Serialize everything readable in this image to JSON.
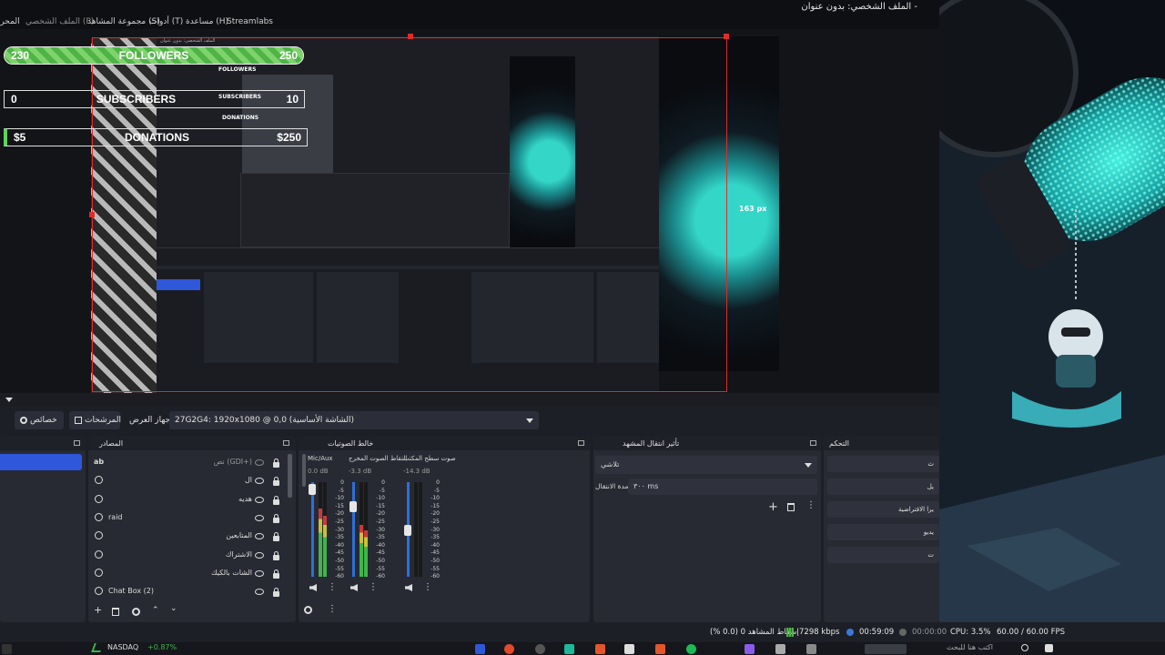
{
  "window": {
    "title": "الملف الشخصي: بدون عنوان -"
  },
  "menu": {
    "items": [
      "المحرر",
      "الملف الشخصي (P)",
      "مجموعة المشاهد (S)",
      "أدوات (T)",
      "مساعدة (H)",
      "Streamlabs"
    ]
  },
  "overlay": {
    "followers": {
      "left": "230",
      "label": "FOLLOWERS",
      "right": "250"
    },
    "subscribers": {
      "left": "0",
      "label": "SUBSCRIBERS",
      "right": "10"
    },
    "donations": {
      "left": "$5",
      "label": "DONATIONS",
      "right": "$250"
    },
    "measure_label": "163 px",
    "inner_followers": "FOLLOWERS",
    "inner_subs": "SUBSCRIBERS",
    "inner_dons": "DONATIONS",
    "inner_title": "الملف الشخصي: بدون عنوان"
  },
  "toolbar": {
    "properties": "خصائص",
    "filters": "المرشحات",
    "device_label": "جهاز العرض",
    "device_value": "27G2G4: 1920x1080 @ 0,0 (الشاشة الأساسية)"
  },
  "sources": {
    "title": "المصادر",
    "items": [
      {
        "name": "نص (GDI+)",
        "icon": "text-icon"
      },
      {
        "name": "ال",
        "icon": "browser-icon"
      },
      {
        "name": "هديه",
        "icon": "browser-icon"
      },
      {
        "name": "raid",
        "icon": "browser-icon"
      },
      {
        "name": "المتابعين",
        "icon": "browser-icon"
      },
      {
        "name": "الاشتراك",
        "icon": "browser-icon"
      },
      {
        "name": "الشات بالكيك",
        "icon": "browser-icon"
      },
      {
        "name": "Chat Box (2)",
        "icon": "browser-icon"
      }
    ],
    "text_icon_glyph": "ab"
  },
  "mixer": {
    "title": "خالط الصوتيات",
    "channels": [
      {
        "name": "Mic/Aux",
        "db": "0.0 dB",
        "level": 0.72,
        "fader": 0.98
      },
      {
        "name": "التقاط الصوت المخرج",
        "db": "-3.3 dB",
        "level": 0.55,
        "fader": 0.8
      },
      {
        "name": "صوت سطح المكتب",
        "db": "-14.3 dB",
        "level": 0.0,
        "fader": 0.55
      }
    ],
    "scale": [
      "0",
      "-5",
      "-10",
      "-15",
      "-20",
      "-25",
      "-30",
      "-35",
      "-40",
      "-45",
      "-50",
      "-55",
      "-60"
    ]
  },
  "transitions": {
    "title": "تأثير انتقال المشهد",
    "type": "تلاشي",
    "duration_label": "مدة الانتقال",
    "duration_value": "٣٠٠ ms"
  },
  "controls": {
    "title": "التحكم",
    "buttons": [
      "ث",
      "يل",
      "يرا الافتراضية",
      "يديو",
      "ت"
    ]
  },
  "status": {
    "dropped": "إسقاط المشاهد 0 (0.0 %)",
    "bitrate": "7298 kbps",
    "stream_time": "00:59:09",
    "rec_time": "00:00:00",
    "cpu": "CPU: 3.5%",
    "fps": "60.00 / 60.00 FPS"
  },
  "taskbar": {
    "ticker_name": "NASDAQ",
    "ticker_change": "+0.87%",
    "search_hint": "اكتب هنا للبحث"
  },
  "colors": {
    "accent": "#2f57d9",
    "followers_bar": "#5cc34f",
    "preview_border": "#e02b2b"
  }
}
